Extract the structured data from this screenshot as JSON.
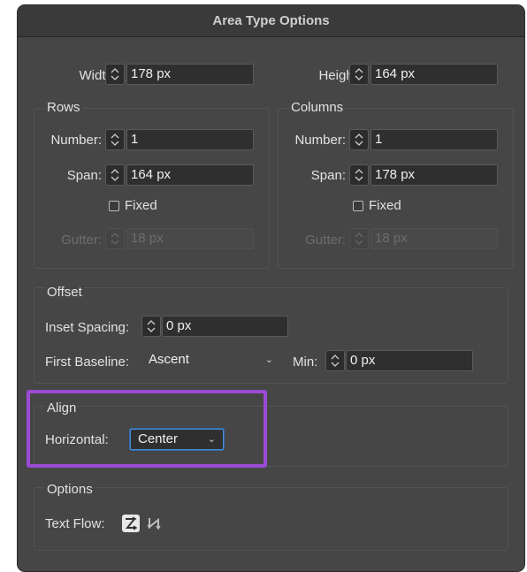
{
  "dialog": {
    "title": "Area Type Options"
  },
  "size": {
    "width_label": "Width:",
    "width_value": "178 px",
    "height_label": "Height:",
    "height_value": "164 px"
  },
  "rows": {
    "title": "Rows",
    "number_label": "Number:",
    "number_value": "1",
    "span_label": "Span:",
    "span_value": "164 px",
    "fixed_label": "Fixed",
    "gutter_label": "Gutter:",
    "gutter_value": "18 px"
  },
  "columns": {
    "title": "Columns",
    "number_label": "Number:",
    "number_value": "1",
    "span_label": "Span:",
    "span_value": "178 px",
    "fixed_label": "Fixed",
    "gutter_label": "Gutter:",
    "gutter_value": "18 px"
  },
  "offset": {
    "title": "Offset",
    "inset_label": "Inset Spacing:",
    "inset_value": "0 px",
    "baseline_label": "First Baseline:",
    "baseline_value": "Ascent",
    "min_label": "Min:",
    "min_value": "0 px"
  },
  "align": {
    "title": "Align",
    "horizontal_label": "Horizontal:",
    "horizontal_value": "Center"
  },
  "options": {
    "title": "Options",
    "text_flow_label": "Text Flow:"
  },
  "colors": {
    "dialog_bg": "#464646",
    "accent_focus": "#4a90d9",
    "highlight": "#9b4bd4"
  },
  "icons": {
    "stepper": "up-down-chevron-icon",
    "text_flow_rows": "text-flow-rows-icon",
    "text_flow_columns": "text-flow-columns-icon"
  }
}
